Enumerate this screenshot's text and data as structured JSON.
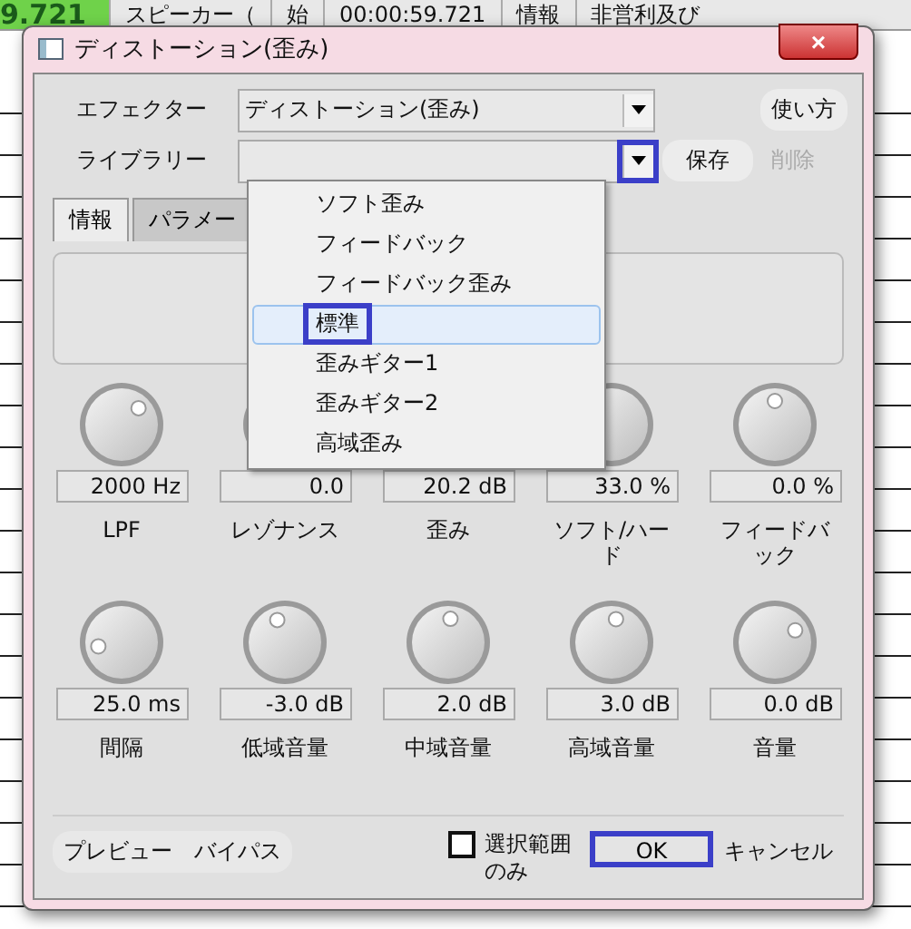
{
  "background_app": {
    "time_display": "9.721",
    "toolbar": [
      "スピーカー（",
      "始",
      "00:00:59.721",
      "情報",
      "非営利及び"
    ]
  },
  "dialog": {
    "title": "ディストーション(歪み)",
    "close": "×",
    "effector": {
      "label": "エフェクター",
      "value": "ディストーション(歪み)",
      "help": "使い方"
    },
    "library": {
      "label": "ライブラリー",
      "highlighted": true,
      "save": "保存",
      "delete": "削除",
      "delete_disabled": true
    },
    "tabs": [
      {
        "label": "情報",
        "selected": true
      },
      {
        "label": "パラメー",
        "selected": false
      }
    ],
    "library_menu": [
      {
        "label": "ソフト歪み",
        "selected": false,
        "highlighted": false
      },
      {
        "label": "フィードバック",
        "selected": false,
        "highlighted": false
      },
      {
        "label": "フィードバック歪み",
        "selected": false,
        "highlighted": false
      },
      {
        "label": "標準",
        "selected": true,
        "highlighted": true
      },
      {
        "label": "歪みギター1",
        "selected": false,
        "highlighted": false
      },
      {
        "label": "歪みギター2",
        "selected": false,
        "highlighted": false
      },
      {
        "label": "高域歪み",
        "selected": false,
        "highlighted": false
      }
    ],
    "knobs": [
      {
        "value": "2000 Hz",
        "label": "LPF",
        "level": 0.67
      },
      {
        "value": "0.0",
        "label": "レゾナンス"
      },
      {
        "value": "20.2 dB",
        "label": "歪み"
      },
      {
        "value": "33.0 %",
        "label": "ソフト/ハード"
      },
      {
        "value": "0.0 %",
        "label": "フィードバック",
        "level": 0.5
      },
      {
        "value": "25.0 ms",
        "label": "間隔",
        "level": 0.13
      },
      {
        "value": "-3.0 dB",
        "label": "低域音量",
        "level": 0.43
      },
      {
        "value": "2.0 dB",
        "label": "中域音量",
        "level": 0.52
      },
      {
        "value": "3.0 dB",
        "label": "高域音量",
        "level": 0.54
      },
      {
        "value": "0.0 dB",
        "label": "音量",
        "level": 0.72
      }
    ],
    "preview": "プレビュー",
    "bypass": "バイパス",
    "selection_only": {
      "label": "選択範囲のみ",
      "checked": false
    },
    "ok": {
      "label": "OK",
      "highlighted": true
    },
    "cancel": "キャンセル"
  }
}
